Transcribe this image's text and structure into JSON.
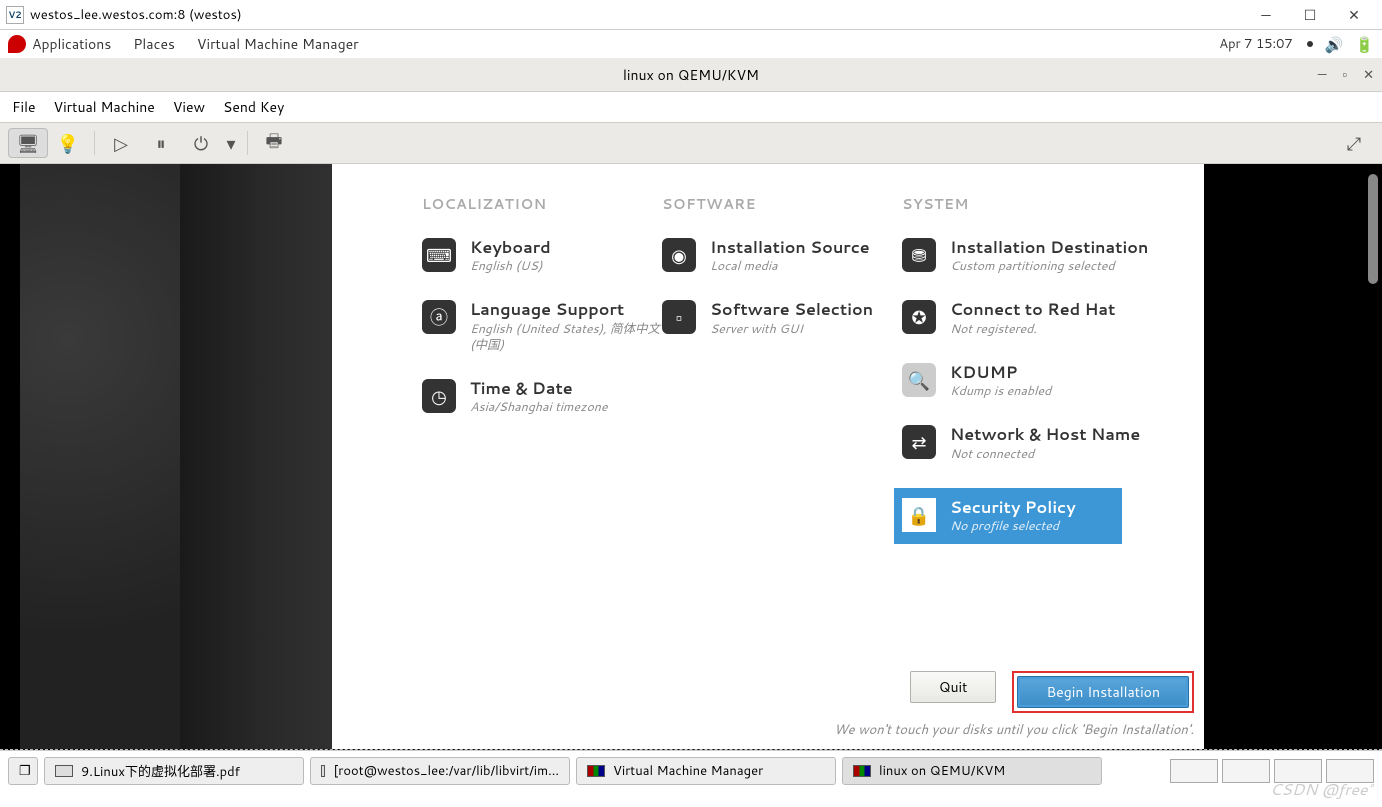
{
  "vnc": {
    "title": "westos_lee.westos.com:8 (westos)",
    "icon_label": "V2"
  },
  "gnome": {
    "apps": "Applications",
    "places": "Places",
    "vmm": "Virtual Machine Manager",
    "date": "Apr 7  15:07"
  },
  "vm_window": {
    "title": "linux on QEMU/KVM",
    "menu": {
      "file": "File",
      "vm": "Virtual Machine",
      "view": "View",
      "sendkey": "Send Key"
    }
  },
  "installer": {
    "localization": {
      "header": "LOCALIZATION",
      "keyboard": {
        "title": "Keyboard",
        "sub": "English (US)"
      },
      "lang": {
        "title": "Language Support",
        "sub": "English (United States), 简体中文 (中国)"
      },
      "time": {
        "title": "Time & Date",
        "sub": "Asia/Shanghai timezone"
      }
    },
    "software": {
      "header": "SOFTWARE",
      "source": {
        "title": "Installation Source",
        "sub": "Local media"
      },
      "selection": {
        "title": "Software Selection",
        "sub": "Server with GUI"
      }
    },
    "system": {
      "header": "SYSTEM",
      "dest": {
        "title": "Installation Destination",
        "sub": "Custom partitioning selected"
      },
      "redhat": {
        "title": "Connect to Red Hat",
        "sub": "Not registered."
      },
      "kdump": {
        "title": "KDUMP",
        "sub": "Kdump is enabled"
      },
      "net": {
        "title": "Network & Host Name",
        "sub": "Not connected"
      },
      "sec": {
        "title": "Security Policy",
        "sub": "No profile selected"
      }
    },
    "buttons": {
      "quit": "Quit",
      "begin": "Begin Installation"
    },
    "hint": "We won't touch your disks until you click 'Begin Installation'."
  },
  "taskbar": {
    "t1": "9.Linux下的虚拟化部署.pdf",
    "t2": "[root@westos_lee:/var/lib/libvirt/im...",
    "t3": "Virtual Machine Manager",
    "t4": "linux on QEMU/KVM"
  },
  "watermark": "CSDN @free°"
}
